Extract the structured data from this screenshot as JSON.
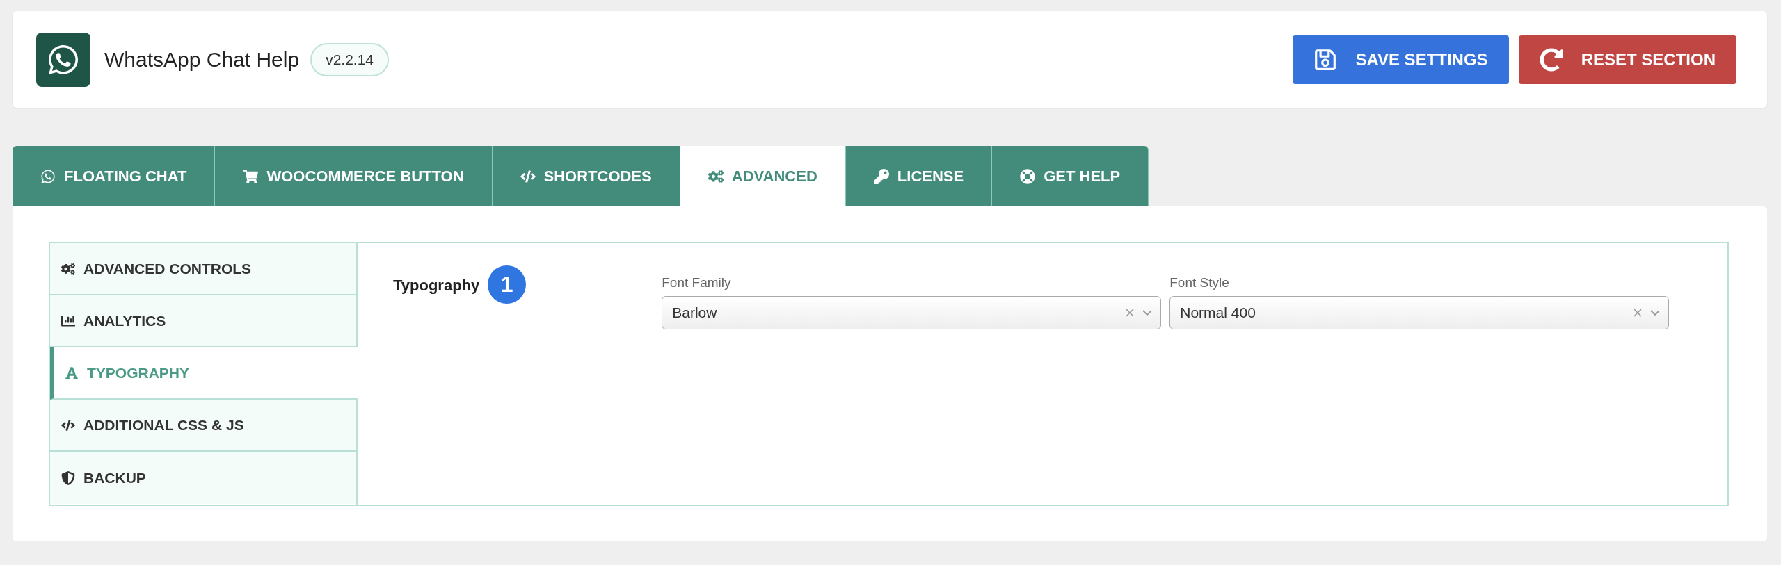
{
  "header": {
    "title": "WhatsApp Chat Help",
    "version": "v2.2.14",
    "buttons": [
      {
        "kind": "save",
        "label": "SAVE SETTINGS"
      },
      {
        "kind": "reset",
        "label": "RESET SECTION"
      }
    ]
  },
  "tabs": [
    {
      "label": "FLOATING CHAT",
      "selected": false
    },
    {
      "label": "WOOCOMMERCE BUTTON",
      "selected": false
    },
    {
      "label": "SHORTCODES",
      "selected": false
    },
    {
      "label": "ADVANCED",
      "selected": true
    },
    {
      "label": "LICENSE",
      "selected": false
    },
    {
      "label": "GET HELP",
      "selected": false
    }
  ],
  "sidebar": {
    "items": [
      {
        "label": "ADVANCED CONTROLS",
        "selected": false
      },
      {
        "label": "ANALYTICS",
        "selected": false
      },
      {
        "label": "TYPOGRAPHY",
        "selected": true
      },
      {
        "label": "ADDITIONAL CSS & JS",
        "selected": false
      },
      {
        "label": "BACKUP",
        "selected": false
      }
    ]
  },
  "section": {
    "title": "Typography",
    "step_badge": "1",
    "fields": [
      {
        "label": "Font Family",
        "value": "Barlow"
      },
      {
        "label": "Font Style",
        "value": "Normal 400"
      }
    ]
  }
}
